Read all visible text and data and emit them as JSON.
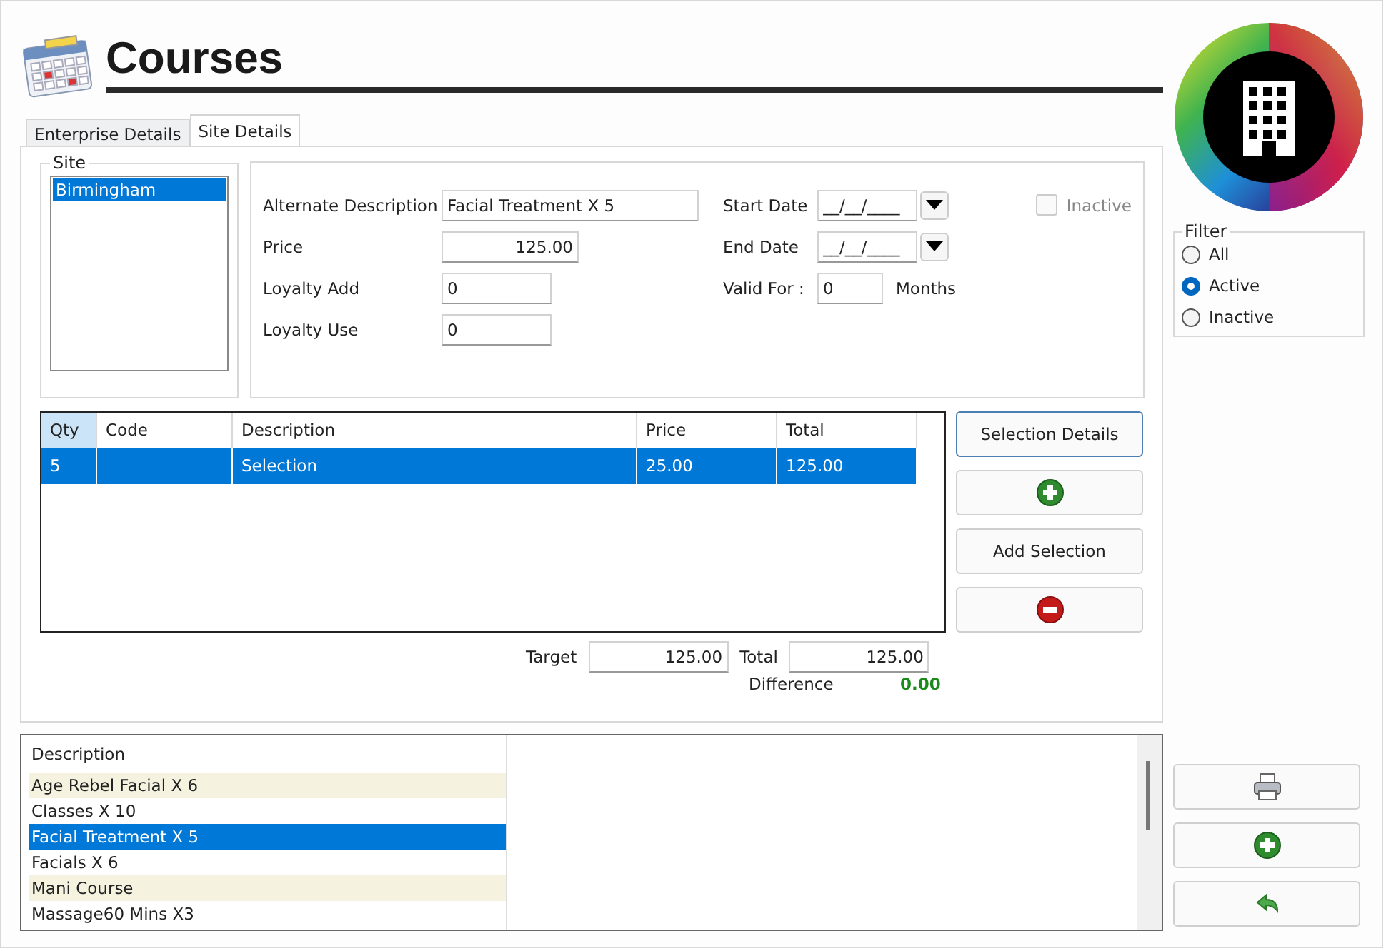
{
  "title": "Courses",
  "tabs": [
    {
      "label": "Enterprise Details",
      "selected": false
    },
    {
      "label": "Site Details",
      "selected": true
    }
  ],
  "site": {
    "legend": "Site",
    "items": [
      {
        "label": "Birmingham",
        "selected": true
      }
    ]
  },
  "fields_left": [
    {
      "label": "Alternate Description",
      "value": "Facial Treatment X 5"
    },
    {
      "label": "Price",
      "value": "125.00"
    },
    {
      "label": "Loyalty Add",
      "value": "0"
    },
    {
      "label": "Loyalty Use",
      "value": "0"
    }
  ],
  "start_date": {
    "label": "Start Date",
    "value": "__/__/____"
  },
  "end_date": {
    "label": "End Date",
    "value": "__/__/____"
  },
  "valid_for": {
    "label": "Valid For :",
    "value": "0",
    "unit": "Months"
  },
  "inactive": {
    "label": "Inactive",
    "checked": false
  },
  "grid": {
    "columns": [
      "Qty",
      "Code",
      "Description",
      "Price",
      "Total"
    ],
    "rows": [
      {
        "cells": [
          "5",
          "",
          "Selection",
          "25.00",
          "125.00"
        ],
        "selected": true
      }
    ]
  },
  "side_buttons": [
    {
      "kind": "text",
      "label": "Selection Details"
    },
    {
      "kind": "add"
    },
    {
      "kind": "text",
      "label": "Add Selection"
    },
    {
      "kind": "remove"
    }
  ],
  "target": {
    "label": "Target",
    "value": "125.00"
  },
  "total": {
    "label": "Total",
    "value": "125.00"
  },
  "difference": {
    "label": "Difference",
    "value": "0.00"
  },
  "list": {
    "column": "Description",
    "items": [
      {
        "label": "Age Rebel Facial X 6",
        "selected": false
      },
      {
        "label": "Classes X 10",
        "selected": false
      },
      {
        "label": "Facial Treatment X 5",
        "selected": true
      },
      {
        "label": "Facials X 6",
        "selected": false
      },
      {
        "label": "Mani Course",
        "selected": false
      },
      {
        "label": "Massage60 Mins X3",
        "selected": false
      }
    ]
  },
  "filter": {
    "legend": "Filter",
    "options": [
      {
        "label": "All",
        "selected": false
      },
      {
        "label": "Active",
        "selected": true
      },
      {
        "label": "Inactive",
        "selected": false
      }
    ]
  },
  "bottom_buttons": [
    {
      "kind": "print"
    },
    {
      "kind": "add"
    },
    {
      "kind": "undo"
    }
  ]
}
